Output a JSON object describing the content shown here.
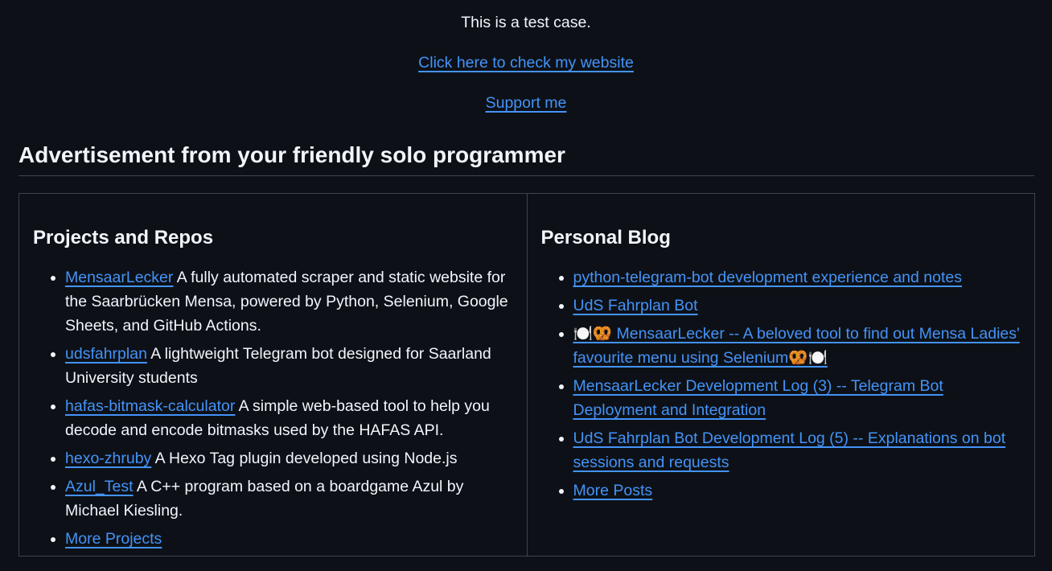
{
  "intro": {
    "text": "This is a test case.",
    "website_link": "Click here to check my website",
    "support_link": "Support me"
  },
  "heading": "Advertisement from your friendly solo programmer",
  "projects": {
    "title": "Projects and Repos",
    "items": [
      {
        "name": "MensaarLecker",
        "desc": " A fully automated scraper and static website for the Saarbrücken Mensa, powered by Python, Selenium, Google Sheets, and GitHub Actions."
      },
      {
        "name": "udsfahrplan",
        "desc": " A lightweight Telegram bot designed for Saarland University students"
      },
      {
        "name": "hafas-bitmask-calculator",
        "desc": " A simple web-based tool to help you decode and encode bitmasks used by the HAFAS API."
      },
      {
        "name": "hexo-zhruby",
        "desc": " A Hexo Tag plugin developed using Node.js"
      },
      {
        "name": "Azul_Test",
        "desc": " A C++ program based on a boardgame Azul by Michael Kiesling."
      }
    ],
    "more": "More Projects"
  },
  "blog": {
    "title": "Personal Blog",
    "items": [
      "python-telegram-bot development experience and notes",
      "UdS Fahrplan Bot",
      "🍽️🥨 MensaarLecker -- A beloved tool to find out Mensa Ladies' favourite menu using Selenium🥨🍽️",
      "MensaarLecker Development Log (3) -- Telegram Bot Deployment and Integration",
      "UdS Fahrplan Bot Development Log (5) -- Explanations on bot sessions and requests"
    ],
    "more": "More Posts"
  },
  "colors": {
    "background": "#0d1117",
    "text": "#f0f6fc",
    "link": "#4493f8",
    "border": "#3d444d"
  }
}
